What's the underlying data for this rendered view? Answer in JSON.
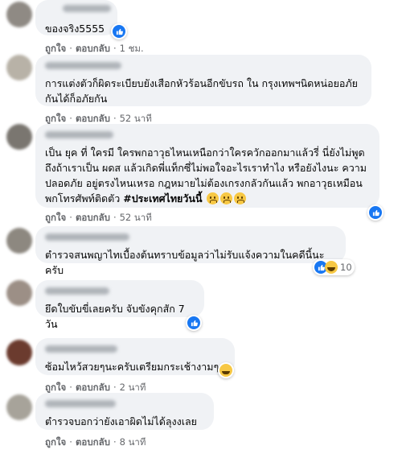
{
  "actions": {
    "like": "ถูกใจ",
    "reply": "ตอบกลับ",
    "sep": "·"
  },
  "comments": [
    {
      "text": "ของจริง5555",
      "time": "1 ชม.",
      "reaction_count": ""
    },
    {
      "text": "การแต่งตัวก็ผิดระเบียบยังเสือกหัวร้อนอีกขับรถ ใน กรุงเทพฯนิดหน่อยอภัยกันได้ก็อภัยกัน",
      "time": "52 นาที",
      "reaction_count": ""
    },
    {
      "text": "เป็น ยุค ที่ ใครมี ใครพกอาวุธไหนเหนือกว่าใครควักออกมาแล้วรี่ นี่ยังไม่พูดถึงถ้าเราเป็น ผดส แล้วเกิดพี่แท็กซี่ไม่พอใจอะไรเราทำไง หรือยังไงนะ ความปลอดภัย อยู่ตรงไหนเหรอ กฎหมายไม่ต้องเกรงกลัวกันแล้ว พกอาวุธเหมือนพกโทรศัพท์ติดตัว",
      "hashtag": "#ประเทศไทยวันนี้",
      "time": "52 นาที",
      "reaction_count": ""
    },
    {
      "text": "ตำรวจสนพญาไทเบื้องต้นทราบข้อมูลว่าไม่รับแจ้งความในคดีนี้นะครับ",
      "time": "52 นาที",
      "reaction_count": "10"
    },
    {
      "text": "ยึดใบขับขี่เลยครับ จับขังคุกสัก 7 วัน",
      "time": "",
      "reaction_count": ""
    },
    {
      "text": "ซ้อมไหว้สวยๆนะครับเตรียมกระเช้างามๆ",
      "time": "2 นาที",
      "reaction_count": ""
    },
    {
      "text": "ตำรวจบอกว่ายังเอาผิดไม่ได้ลุงงเลย",
      "time": "8 นาที",
      "reaction_count": ""
    }
  ],
  "colors": {
    "bubble": "#f0f2f5",
    "meta": "#65676b",
    "like_blue": "#1877f2",
    "text": "#050505"
  }
}
